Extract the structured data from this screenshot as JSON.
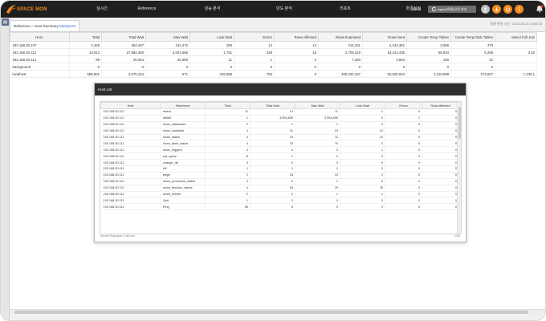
{
  "app": {
    "logo_text": "SPACE MON"
  },
  "nav": {
    "items": [
      {
        "label": "실시간",
        "name": "nav-realtime"
      },
      {
        "label": "Reference",
        "name": "nav-reference"
      },
      {
        "label": "성능 분석",
        "name": "nav-performance"
      },
      {
        "label": "빈도 분석",
        "name": "nav-frequency"
      },
      {
        "label": "리포트",
        "name": "nav-report"
      },
      {
        "label": "환경설정",
        "name": "nav-settings"
      }
    ],
    "user": "admin",
    "agent_button": "Agent(목록)으로 보기"
  },
  "colors": {
    "accent_orange": "#f28a1e",
    "topbar": "#1f1f1f",
    "link": "#2b6fc9",
    "circle_gray": "#bdbdbd"
  },
  "breadcrumb": {
    "root": "Reference",
    "sep": ">",
    "page": "Host Summary",
    "link": "MySQL03"
  },
  "update_time": "최종 변경 시간 : 2018-06-11 14:06:15",
  "main_table": {
    "columns": [
      "Host",
      "Total",
      "Total Wait",
      "Max Wait",
      "Lock Wait",
      "Errors",
      "Rows Affected",
      "Rows Examined",
      "Rows Sent",
      "Create Temp Tables",
      "Create Temp Disk Tables",
      "Select Full Join"
    ],
    "rows": [
      [
        "192.168.30.107",
        "2,328",
        "364,457",
        "243,472",
        "250",
        "14",
        "14",
        "216,331",
        "2,043,361",
        "3,056",
        "370",
        ""
      ],
      [
        "192.168.30.112",
        "13,613",
        "27,884,460",
        "5,001,686",
        "1,751",
        "248",
        "15",
        "2,705,319",
        "19,414,435",
        "68,833",
        "6,258",
        "3,42"
      ],
      [
        "192.168.30.114",
        "99",
        "26,064",
        "25,980",
        "11",
        "1",
        "0",
        "7,320",
        "3,684",
        "150",
        "32",
        ""
      ],
      [
        "background",
        "0",
        "0",
        "0",
        "0",
        "0",
        "0",
        "0",
        "0",
        "0",
        "0",
        ""
      ],
      [
        "localhost",
        "559,901",
        "2,675,234",
        "571",
        "249,388",
        "753",
        "0",
        "409,220,187",
        "52,820,604",
        "1,149,598",
        "273,927",
        "1,230,1"
      ]
    ]
  },
  "popup": {
    "title": "Host List",
    "columns": [
      "Host",
      "Statement",
      "Total",
      "Total Wait",
      "Max Wait",
      "Lock Wait",
      "Errors",
      "Rows Affected"
    ],
    "rows": [
      [
        "192.168.30.112",
        "select",
        "11",
        "14",
        "11",
        "1",
        "0",
        "0"
      ],
      [
        "192.168.30.112",
        "delete",
        "1",
        "3,554,839",
        "3,554,839",
        "0",
        "1",
        "0"
      ],
      [
        "192.168.30.112",
        "show_databases",
        "2",
        "2",
        "1",
        "0",
        "0",
        "0"
      ],
      [
        "192.168.30.112",
        "show_variables",
        "4",
        "31",
        "23",
        "12",
        "0",
        "0"
      ],
      [
        "192.168.30.112",
        "show_status",
        "4",
        "19",
        "11",
        "10",
        "0",
        "0"
      ],
      [
        "192.168.30.112",
        "show_table_status",
        "4",
        "78",
        "70",
        "0",
        "0",
        "0"
      ],
      [
        "192.168.30.112",
        "show_triggers",
        "4",
        "4",
        "2",
        "1",
        "0",
        "0"
      ],
      [
        "192.168.30.112",
        "set_option",
        "8",
        "1",
        "0",
        "0",
        "0",
        "0"
      ],
      [
        "192.168.30.112",
        "change_db",
        "3",
        "0",
        "0",
        "0",
        "0",
        "0"
      ],
      [
        "192.168.30.112",
        "kill",
        "1",
        "0",
        "0",
        "0",
        "0",
        "0"
      ],
      [
        "192.168.30.112",
        "begin",
        "2",
        "18",
        "15",
        "0",
        "0",
        "0"
      ],
      [
        "192.168.30.112",
        "show_procedure_status",
        "4",
        "9",
        "1",
        "0",
        "0",
        "0"
      ],
      [
        "192.168.30.112",
        "show_function_status",
        "4",
        "54",
        "29",
        "25",
        "0",
        "0"
      ],
      [
        "192.168.30.112",
        "show_events",
        "2",
        "2",
        "1",
        "1",
        "0",
        "0"
      ],
      [
        "192.168.30.112",
        "Quit",
        "1",
        "0",
        "0",
        "0",
        "0",
        "0"
      ],
      [
        "192.168.30.112",
        "Ping",
        "59",
        "8",
        "0",
        "0",
        "0",
        "0"
      ]
    ],
    "footer_left": "Server Response 0.454 sec",
    "footer_right": "1/16"
  }
}
